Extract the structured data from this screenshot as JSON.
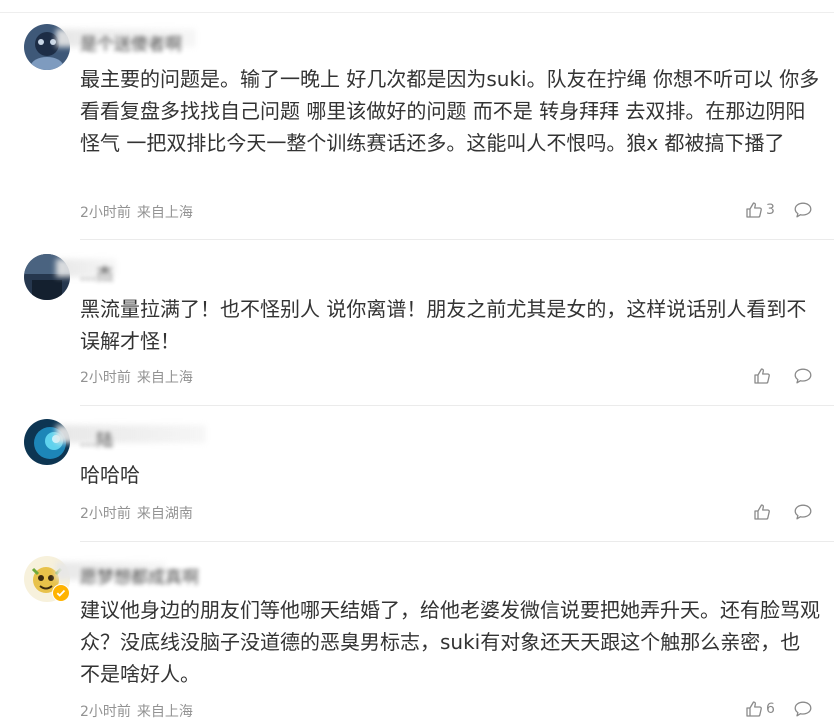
{
  "comments": [
    {
      "username": "是个送傻者啊",
      "text": "最主要的问题是。输了一晚上 好几次都是因为suki。队友在拧绳 你想不听可以 你多看看复盘多找找自己问题 哪里该做好的问题 而不是 转身拜拜 去双排。在那边阴阳怪气 一把双排比今天一整个训练赛话还多。这能叫人不恨吗。狼x 都被搞下播了",
      "time": "2小时前",
      "location": "来自上海",
      "likes": "3"
    },
    {
      "username": "...杰",
      "text": "黑流量拉满了！也不怪别人 说你离谱！朋友之前尤其是女的，这样说话别人看到不误解才怪！",
      "time": "2小时前",
      "location": "来自上海",
      "likes": ""
    },
    {
      "username": "...陆",
      "text": "哈哈哈",
      "time": "2小时前",
      "location": "来自湖南",
      "likes": ""
    },
    {
      "username": "愿梦想都成真啊",
      "text": "建议他身边的朋友们等他哪天结婚了，给他老婆发微信说要把她弄升天。还有脸骂观众？没底线没脑子没道德的恶臭男标志，suki有对象还天天跟这个触那么亲密，也不是啥好人。",
      "time": "2小时前",
      "location": "来自上海",
      "likes": "6"
    }
  ],
  "icons": {
    "like": "thumbs-up-icon",
    "reply": "comment-bubble-icon"
  },
  "colors": {
    "text": "#333333",
    "meta": "#939393",
    "icon": "#8a8a8a",
    "divider": "#ebebeb"
  }
}
